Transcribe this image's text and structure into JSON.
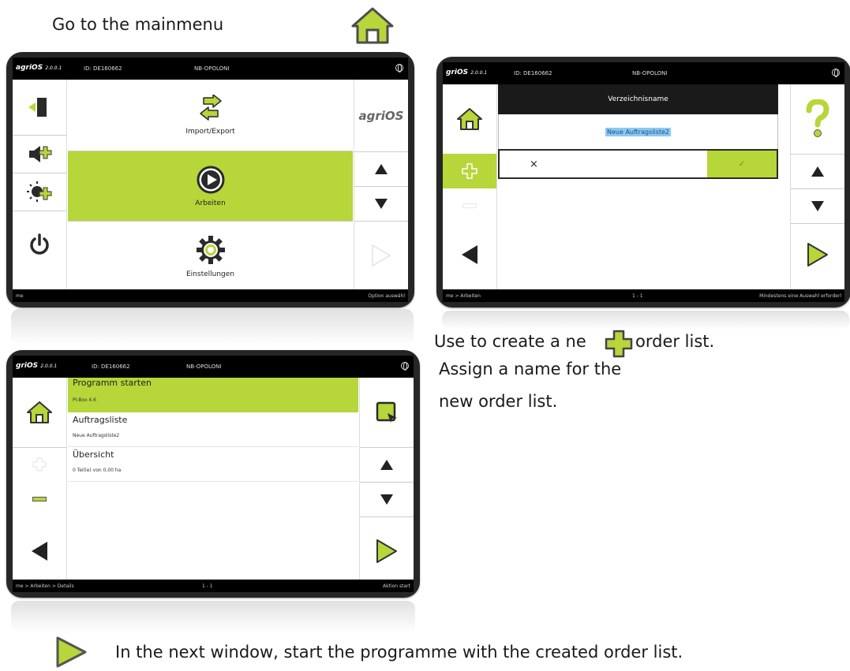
{
  "captions": {
    "mainmenu": "Go to the mainmenu",
    "create_line1_part1": "Use to create a ne",
    "create_line1_part2": "order list.",
    "create_line2": "Assign a name for the",
    "create_line3": "new order list.",
    "bottom": "In the next window, start the programme with the created order list."
  },
  "colors": {
    "accent": "#b6d63a",
    "bezel": "#262626",
    "dark_icon": "#222222"
  },
  "tablet1": {
    "version": "agriOS",
    "version_num": "2.0.0.1",
    "id": "ID: DE160662",
    "device": "NB-OPOLONI",
    "brand": "agriOS",
    "menu": [
      {
        "label": "Import/Export",
        "icon": "import-export-icon"
      },
      {
        "label": "Arbeiten",
        "icon": "play-icon"
      },
      {
        "label": "Einstellungen",
        "icon": "gear-icon"
      }
    ],
    "footer_left": "me",
    "footer_right": "Option auswähl"
  },
  "tablet2": {
    "version": "griOS",
    "version_num": "2.0.0.1",
    "id": "ID: DE160662",
    "device": "NB-OPOLONI",
    "dialog_title": "Verzeichnisname",
    "dialog_value": "Neue Auftragsliste2",
    "cancel_symbol": "×",
    "confirm_symbol": "✓",
    "footer_left": "me > Arbeiten",
    "footer_mid": "1 - 1",
    "footer_right": "Mindestens eine Auswahl erforderl"
  },
  "tablet3": {
    "version": "griOS",
    "version_num": "2.0.0.1",
    "id": "ID: DE160662",
    "device": "NB-OPOLONI",
    "rows": [
      {
        "title": "Programm starten",
        "sub": "PI-Box 4.6"
      },
      {
        "title": "Auftragsliste",
        "sub": "Neue Auftragsliste2"
      },
      {
        "title": "Übersicht",
        "sub": "0 Teil(e) von 0,00 ha"
      }
    ],
    "footer_left": "me > Arbeiten > Details",
    "footer_mid": "1 - 1",
    "footer_right": "Aktion start"
  }
}
